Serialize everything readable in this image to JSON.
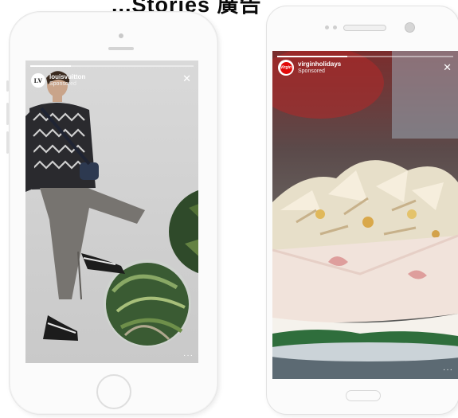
{
  "header": {
    "partial_title": "...Stories 廣告"
  },
  "ads": [
    {
      "account": "louisvuitton",
      "sponsored": "Sponsored",
      "avatar_monogram": "LV",
      "close_icon": "close-icon",
      "more_icon": "more-icon",
      "progress": 0.25,
      "colors": {
        "bg": "#d3d3d3",
        "text": "#ffffff"
      }
    },
    {
      "account": "virginholidays",
      "sponsored": "Sponsored",
      "avatar_monogram": "Virgin",
      "close_icon": "close-icon",
      "more_icon": "more-icon",
      "progress": 0.4,
      "colors": {
        "brand": "#e10a0a",
        "text": "#ffffff"
      }
    }
  ]
}
